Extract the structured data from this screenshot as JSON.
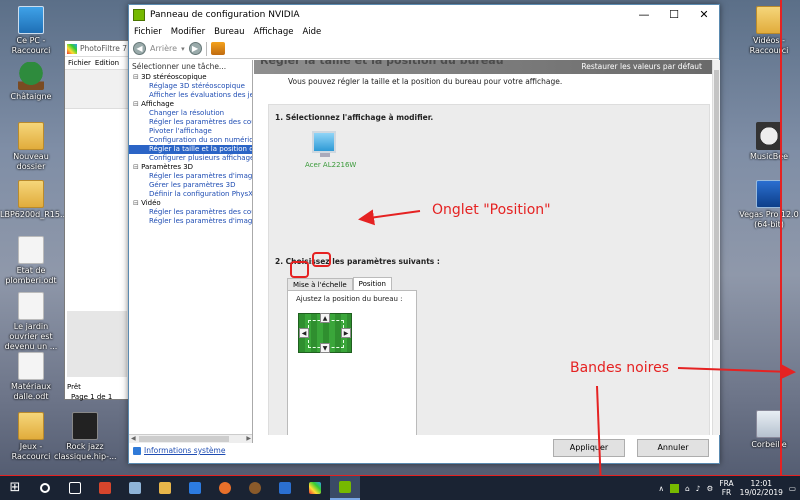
{
  "desktop": {
    "icons_left": [
      {
        "label": "Ce PC - Raccourci"
      },
      {
        "label": "Châtaigne"
      },
      {
        "label": "Nouveau dossier"
      },
      {
        "label": "LBP6200d_R15..."
      },
      {
        "label": "Etat de plomberi.odt"
      },
      {
        "label": "Le jardin ouvrier est devenu un ..."
      },
      {
        "label": "Matériaux dalle.odt"
      },
      {
        "label": "Jeux - Raccourci"
      }
    ],
    "icons_second": [
      {
        "label": "Rock jazz classique.hip-..."
      }
    ],
    "icons_right": [
      {
        "label": "Vidéos - Raccourci"
      },
      {
        "label": "MusicBee"
      },
      {
        "label": "Vegas Pro 12.0 (64-bit)"
      },
      {
        "label": "Corbeille"
      }
    ]
  },
  "photofiltre": {
    "title": "PhotoFiltre 7",
    "menu": [
      "Fichier",
      "Edition"
    ],
    "status": "Prêt",
    "page": "Page 1 de 1"
  },
  "nvidia": {
    "title": "Panneau de configuration NVIDIA",
    "menu": [
      "Fichier",
      "Modifier",
      "Bureau",
      "Affichage",
      "Aide"
    ],
    "toolbar_back": "Arrière",
    "tree_header": "Sélectionner une tâche...",
    "tree": [
      {
        "type": "cat",
        "label": "3D stéréoscopique"
      },
      {
        "type": "item",
        "label": "Réglage 3D stéréoscopique"
      },
      {
        "type": "item",
        "label": "Afficher les évaluations des jeux"
      },
      {
        "type": "cat",
        "label": "Affichage"
      },
      {
        "type": "item",
        "label": "Changer la résolution"
      },
      {
        "type": "item",
        "label": "Régler les paramètres des couleurs du bureau"
      },
      {
        "type": "item",
        "label": "Pivoter l'affichage"
      },
      {
        "type": "item",
        "label": "Configuration du son numérique"
      },
      {
        "type": "item",
        "label": "Régler la taille et la position du bureau"
      },
      {
        "type": "item",
        "label": "Configurer plusieurs affichages"
      },
      {
        "type": "cat",
        "label": "Paramètres 3D"
      },
      {
        "type": "item",
        "label": "Régler les paramètres d'image avec aperçu"
      },
      {
        "type": "item",
        "label": "Gérer les paramètres 3D"
      },
      {
        "type": "item",
        "label": "Définir la configuration PhysX"
      },
      {
        "type": "cat",
        "label": "Vidéo"
      },
      {
        "type": "item",
        "label": "Régler les paramètres des couleurs vidéo"
      },
      {
        "type": "item",
        "label": "Régler les paramètres d'image vidéo"
      }
    ],
    "selected_index": 8,
    "info_link": "Informations système",
    "header_ghost": "Régler la taille et la position du bureau",
    "restore_label": "Restaurer les valeurs par défaut",
    "intro": "Vous pouvez régler la taille et la position du bureau pour votre affichage.",
    "step1": "1. Sélectionnez l'affichage à modifier.",
    "monitor_label": "Acer AL2216W",
    "step2": "2. Choisissez les paramètres suivants :",
    "tabs": [
      "Mise à l'échelle",
      "Position"
    ],
    "active_tab": 1,
    "adjust_label": "Ajustez la position du bureau :",
    "arrows": {
      "up": "▲",
      "down": "▼",
      "left": "◀",
      "right": "▶"
    },
    "apply_label": "Appliquer",
    "cancel_label": "Annuler"
  },
  "annotations": {
    "onglet": "Onglet \"Position\"",
    "bandes": "Bandes noires",
    "color": "#e52222"
  },
  "taskbar": {
    "lang_top": "FRA",
    "lang_bottom": "FR",
    "time": "12:01",
    "date": "19/02/2019"
  }
}
